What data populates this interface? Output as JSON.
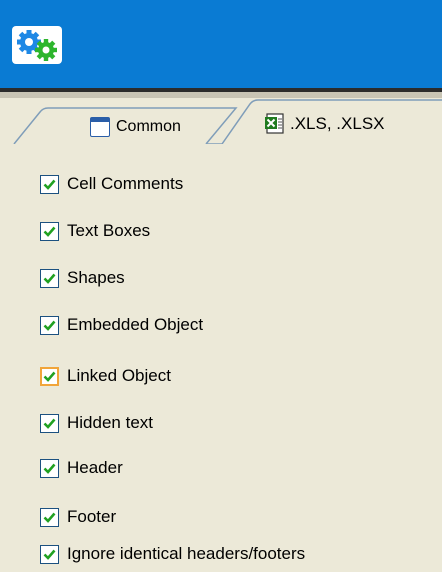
{
  "header": {
    "logo_icon": "gears-icon"
  },
  "tabs": [
    {
      "label": "Common",
      "icon": "window-icon",
      "active": false
    },
    {
      "label": ".XLS, .XLSX",
      "icon": "excel-file-icon",
      "active": true
    }
  ],
  "options": [
    {
      "label": "Cell Comments",
      "checked": true
    },
    {
      "label": "Text Boxes",
      "checked": true
    },
    {
      "label": "Shapes",
      "checked": true
    },
    {
      "label": "Embedded Object",
      "checked": true
    },
    {
      "label": "Linked Object",
      "checked": true,
      "focused": true
    },
    {
      "label": "Hidden text",
      "checked": true
    },
    {
      "label": "Header",
      "checked": true
    },
    {
      "label": "Footer",
      "checked": true
    },
    {
      "label": "Ignore identical headers/footers",
      "checked": true
    }
  ],
  "colors": {
    "header_bg": "#0A7BD3",
    "panel_bg": "#ECE9D8",
    "check_green": "#21A121",
    "focus_orange": "#F1A53A",
    "checkbox_border": "#1C5180"
  }
}
